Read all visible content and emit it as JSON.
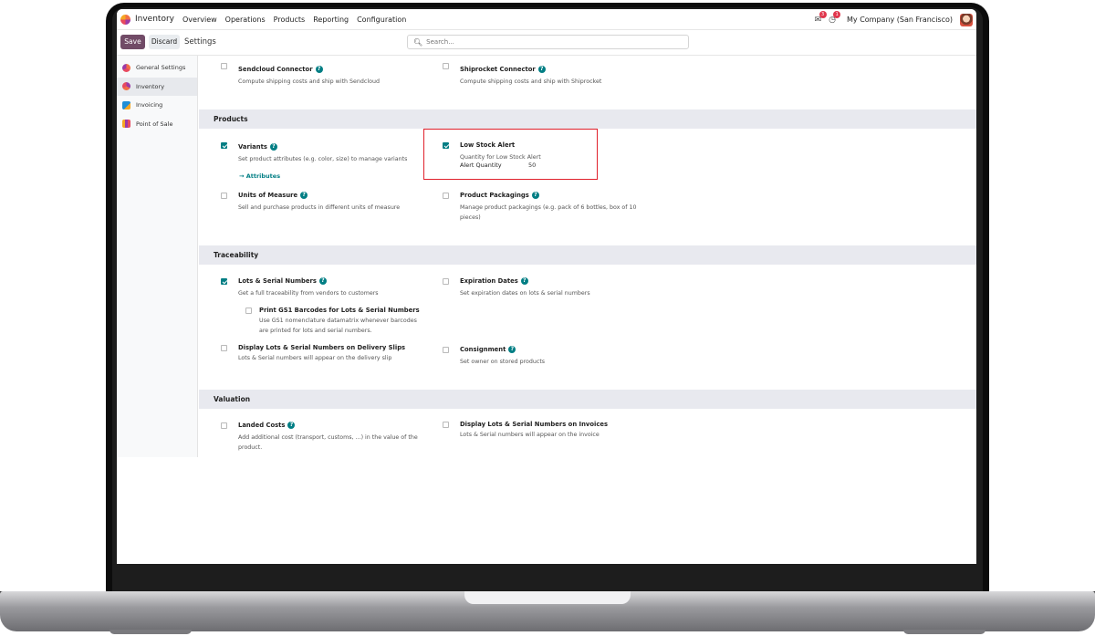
{
  "navbar": {
    "app_name": "Inventory",
    "menu": [
      "Overview",
      "Operations",
      "Products",
      "Reporting",
      "Configuration"
    ],
    "chat_badge": "3",
    "activity_badge": "1",
    "company": "My Company (San Francisco)"
  },
  "control_panel": {
    "save_label": "Save",
    "discard_label": "Discard",
    "title": "Settings",
    "search_placeholder": "Search..."
  },
  "sidebar": {
    "items": [
      {
        "label": "General Settings",
        "icon": "general-settings-icon"
      },
      {
        "label": "Inventory",
        "icon": "inventory-app-icon",
        "active": true
      },
      {
        "label": "Invoicing",
        "icon": "invoicing-app-icon"
      },
      {
        "label": "Point of Sale",
        "icon": "pos-app-icon"
      }
    ]
  },
  "top_settings": {
    "sendcloud": {
      "title": "Sendcloud Connector",
      "desc": "Compute shipping costs and ship with Sendcloud",
      "checked": false
    },
    "shiprocket": {
      "title": "Shiprocket Connector",
      "desc": "Compute shipping costs and ship with Shiprocket",
      "checked": false
    }
  },
  "products": {
    "heading": "Products",
    "variants": {
      "title": "Variants",
      "desc": "Set product attributes (e.g. color, size) to manage variants",
      "link": "Attributes",
      "checked": true
    },
    "low_stock": {
      "title": "Low Stock Alert",
      "desc": "Quantity for Low Stock Alert",
      "field_label": "Alert Quantity",
      "field_value": "50",
      "checked": true
    },
    "uom": {
      "title": "Units of Measure",
      "desc": "Sell and purchase products in different units of measure",
      "checked": false
    },
    "packagings": {
      "title": "Product Packagings",
      "desc": "Manage product packagings (e.g. pack of 6 bottles, box of 10 pieces)",
      "checked": false
    }
  },
  "traceability": {
    "heading": "Traceability",
    "lots": {
      "title": "Lots & Serial Numbers",
      "desc": "Get a full traceability from vendors to customers",
      "checked": true
    },
    "gs1": {
      "title": "Print GS1 Barcodes for Lots & Serial Numbers",
      "desc": "Use GS1 nomenclature datamatrix whenever barcodes are printed for lots and serial numbers.",
      "checked": false
    },
    "expiration": {
      "title": "Expiration Dates",
      "desc": "Set expiration dates on lots & serial numbers",
      "checked": false
    },
    "display_lots_delivery": {
      "title": "Display Lots & Serial Numbers on Delivery Slips",
      "desc": "Lots & Serial numbers will appear on the delivery slip",
      "checked": false
    },
    "consignment": {
      "title": "Consignment",
      "desc": "Set owner on stored products",
      "checked": false
    }
  },
  "valuation": {
    "heading": "Valuation",
    "landed": {
      "title": "Landed Costs",
      "desc": "Add additional cost (transport, customs, ...) in the value of the product.",
      "checked": false
    },
    "display_lots_invoice": {
      "title": "Display Lots & Serial Numbers on Invoices",
      "desc": "Lots & Serial numbers will appear on the invoice",
      "checked": false
    }
  },
  "colors": {
    "primary": "#714b67",
    "accent": "#017e84",
    "highlight": "#e0202b"
  }
}
